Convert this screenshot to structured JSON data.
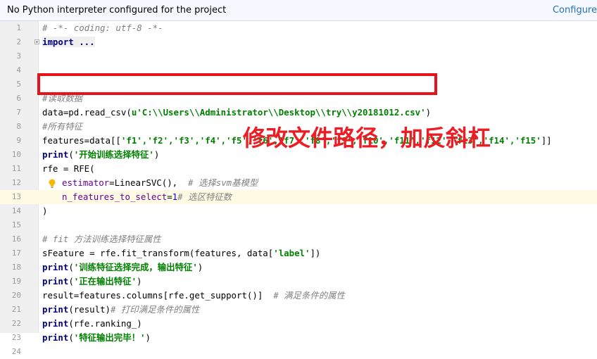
{
  "banner": {
    "message": "No Python interpreter configured for the project",
    "configure_label": "Configure"
  },
  "lines": [
    {
      "n": "1"
    },
    {
      "n": "2"
    },
    {
      "n": "3"
    },
    {
      "n": "4"
    },
    {
      "n": "5"
    },
    {
      "n": "6"
    },
    {
      "n": "7"
    },
    {
      "n": "8"
    },
    {
      "n": "9"
    },
    {
      "n": "10"
    },
    {
      "n": "11"
    },
    {
      "n": "12"
    },
    {
      "n": "13"
    },
    {
      "n": "14"
    },
    {
      "n": "15"
    },
    {
      "n": "16"
    },
    {
      "n": "17"
    },
    {
      "n": "18"
    },
    {
      "n": "19"
    },
    {
      "n": "20"
    },
    {
      "n": "21"
    },
    {
      "n": "22"
    },
    {
      "n": "23"
    },
    {
      "n": "24"
    }
  ],
  "code": {
    "l1_comment": "# -*- coding: utf-8 -*-",
    "l2_import": "import ...",
    "l6_comment": "#读取数据",
    "l7_prefix": "data=pd.read_csv(",
    "l7_str": "u'C:\\\\Users\\\\Administrator\\\\Desktop\\\\try\\\\y20181012.csv'",
    "l7_suffix": ")",
    "l8_comment": "#所有特征",
    "l9_prefix": "features=data[[",
    "l9_str": "'f1','f2','f3','f4','f5','f6','f7','f8','f9','f10','f11','f12','f13','f14','f15'",
    "l9_suffix": "]]",
    "l10_func": "print",
    "l10_open": "(",
    "l10_str": "'开始训练选择特征'",
    "l10_close": ")",
    "l11_text": "rfe = RFE(",
    "l12_param": "estimator",
    "l12_value": "=LinearSVC(),  ",
    "l12_comment": "# 选择svm基模型",
    "l13_param": "n_features_to_select",
    "l13_eq": "=",
    "l13_num": "1",
    "l13_comment": "# 选区特征数",
    "l14_text": ")",
    "l16_comment": "# fit 方法训练选择特征属性",
    "l17_prefix": "sFeature = rfe.fit_transform(features, data[",
    "l17_str": "'label'",
    "l17_suffix": "])",
    "l18_func": "print",
    "l18_open": "(",
    "l18_str": "'训练特征选择完成，输出特征'",
    "l18_close": ")",
    "l19_func": "print",
    "l19_open": "(",
    "l19_str": "'正在输出特征'",
    "l19_close": ")",
    "l20_text": "result=features.columns[rfe.get_support()]  ",
    "l20_comment": "# 满足条件的属性",
    "l21_func": "print",
    "l21_text": "(result)",
    "l21_comment": "# 打印满足条件的属性",
    "l22_func": "print",
    "l22_text": "(rfe.ranking_)",
    "l23_func": "print",
    "l23_open": "(",
    "l23_str": "'特征输出完毕！'",
    "l23_close": ")"
  },
  "annotation": {
    "text": "修改文件路径，加反斜杠",
    "color": "#ee1c24"
  },
  "colors": {
    "keyword": "#000080",
    "string": "#008000",
    "comment": "#808080",
    "number": "#0000ff",
    "parameter": "#660099",
    "highlight_box": "#e8121b"
  },
  "icons": {
    "fold": "fold-expand-icon",
    "bulb": "lightbulb-icon"
  }
}
